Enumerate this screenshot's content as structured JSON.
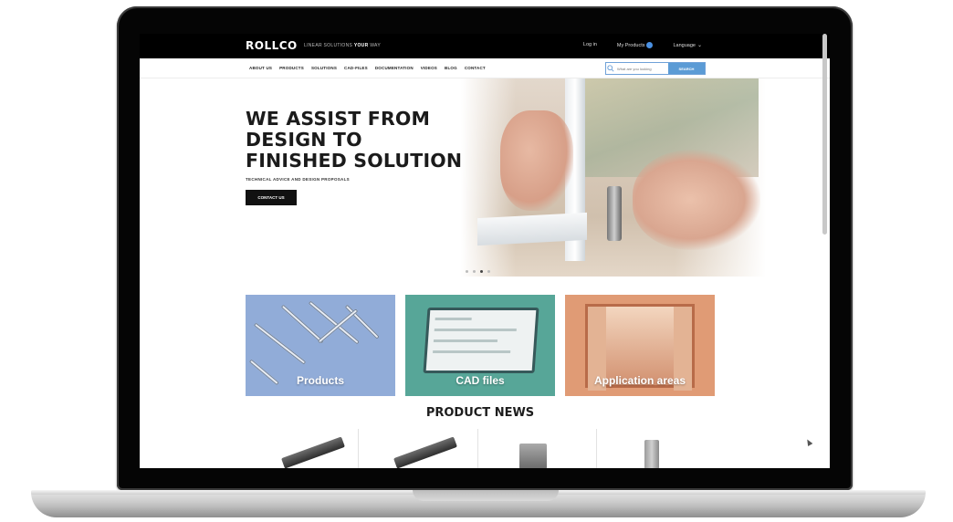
{
  "brand": {
    "logo": "ROLLCO",
    "tagline_prefix": "LINEAR SOLUTIONS",
    "tagline_bold": "YOUR",
    "tagline_suffix": "WAY"
  },
  "topbar": {
    "login": "Log in",
    "my_products": "My Products",
    "language": "Language"
  },
  "nav": {
    "items": [
      "ABOUT US",
      "PRODUCTS",
      "SOLUTIONS",
      "CAD-FILES",
      "DOCUMENTATION",
      "VIDEOS",
      "BLOG",
      "CONTACT"
    ]
  },
  "search": {
    "placeholder": "What are you looking",
    "button": "SEARCH"
  },
  "hero": {
    "title": "WE ASSIST FROM\nDESIGN TO\nFINISHED SOLUTION",
    "subtitle": "TECHNICAL ADVICE AND DESIGN PROPOSALS",
    "cta": "CONTACT US",
    "slide_count": 4,
    "active_slide": 3
  },
  "tiles": [
    {
      "label": "Products",
      "color": "#91acd8"
    },
    {
      "label": "CAD files",
      "color": "#57a698"
    },
    {
      "label": "Application areas",
      "color": "#e09b75"
    }
  ],
  "news": {
    "heading": "PRODUCT NEWS"
  },
  "icons": {
    "search": "search-icon",
    "notification": "badge-icon",
    "language": "chevron-down-icon"
  }
}
